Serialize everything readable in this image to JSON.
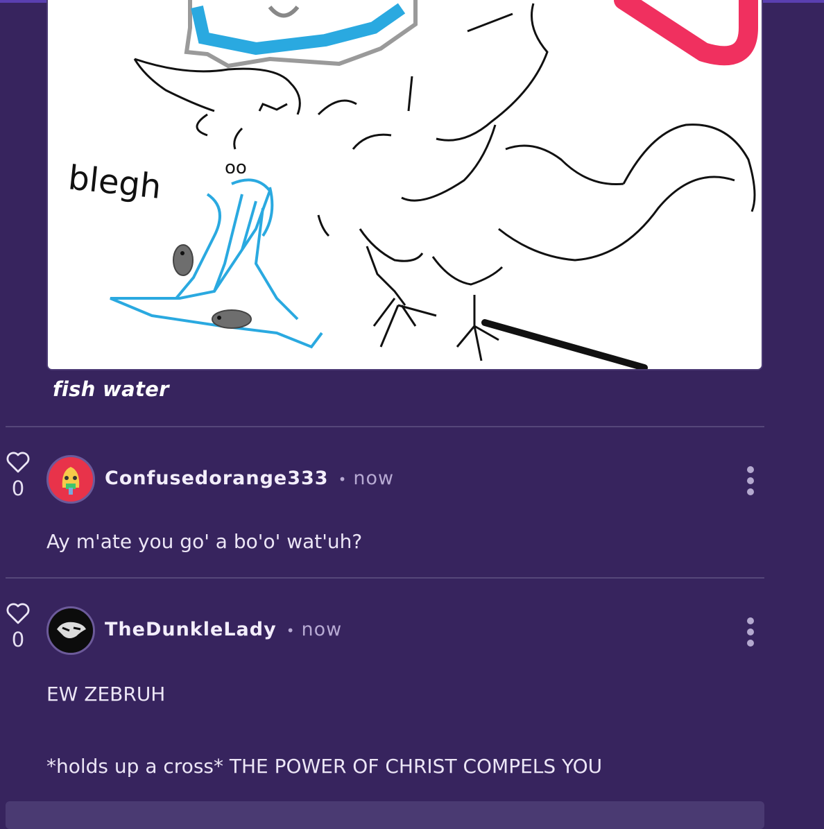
{
  "post": {
    "caption": "fish water",
    "drawing_text": "blegh"
  },
  "comments": [
    {
      "like_count": "0",
      "username": "Confusedorange333",
      "separator": "•",
      "time": "now",
      "lines": [
        "Ay m'ate you go' a bo'o' wat'uh?"
      ]
    },
    {
      "like_count": "0",
      "username": "TheDunkleLady",
      "separator": "•",
      "time": "now",
      "lines": [
        "EW ZEBRUH",
        "*holds up a cross* THE POWER OF CHRIST COMPELS YOU"
      ]
    }
  ],
  "colors": {
    "background": "#37245e",
    "accent_bar": "#5a3fb0",
    "divider": "#56477a",
    "muted_text": "#b7aad3"
  },
  "icons": [
    "heart-outline-icon",
    "kebab-menu-icon"
  ]
}
